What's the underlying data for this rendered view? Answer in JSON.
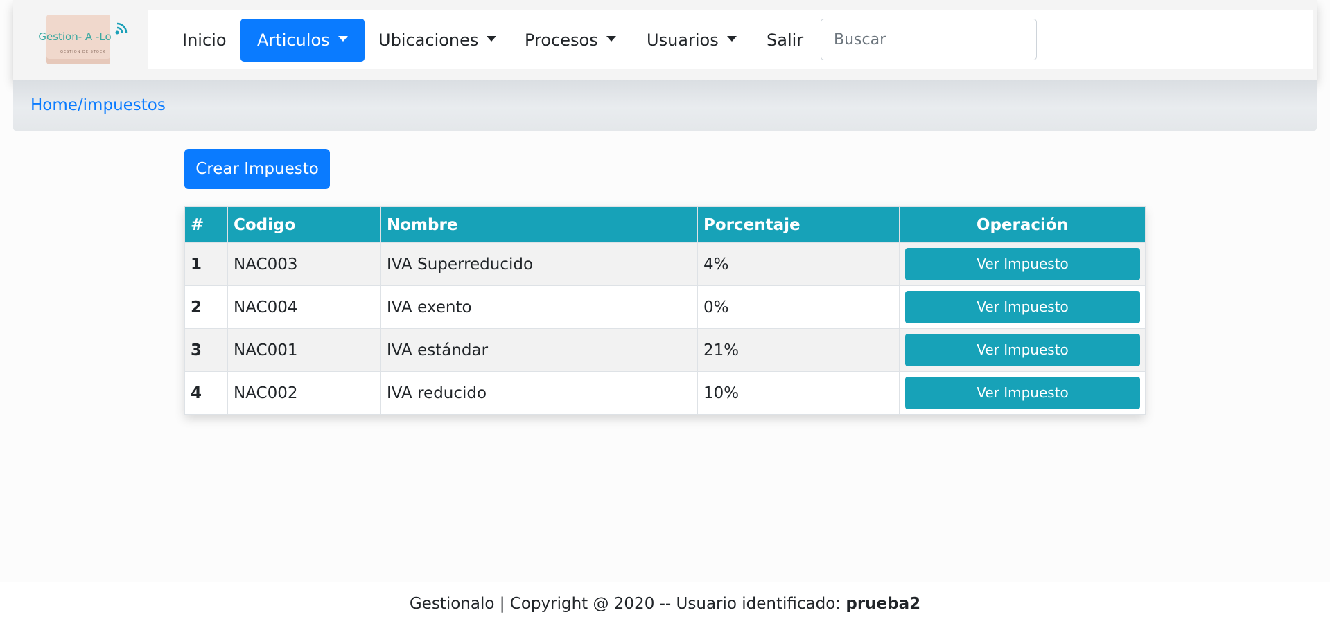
{
  "brand": {
    "logo_text": "Gestion- A -Lo",
    "logo_subtext": "GESTION DE STOCK"
  },
  "nav": {
    "inicio": "Inicio",
    "articulos": "Articulos",
    "ubicaciones": "Ubicaciones",
    "procesos": "Procesos",
    "usuarios": "Usuarios",
    "salir": "Salir",
    "active_item": "Articulos",
    "search_placeholder": "Buscar"
  },
  "breadcrumb": "Home/impuestos",
  "create_button": "Crear Impuesto",
  "table": {
    "headers": [
      "#",
      "Codigo",
      "Nombre",
      "Porcentaje",
      "Operación"
    ],
    "rows": [
      {
        "num": "1",
        "codigo": "NAC003",
        "nombre": "IVA Superreducido",
        "porcentaje": "4%",
        "action": "Ver Impuesto"
      },
      {
        "num": "2",
        "codigo": "NAC004",
        "nombre": "IVA exento",
        "porcentaje": "0%",
        "action": "Ver Impuesto"
      },
      {
        "num": "3",
        "codigo": "NAC001",
        "nombre": "IVA estándar",
        "porcentaje": "21%",
        "action": "Ver Impuesto"
      },
      {
        "num": "4",
        "codigo": "NAC002",
        "nombre": "IVA reducido",
        "porcentaje": "10%",
        "action": "Ver Impuesto"
      }
    ]
  },
  "footer": {
    "text": "Gestionalo | Copyright @ 2020 -- Usuario identificado: ",
    "user": "prueba2"
  },
  "colors": {
    "primary": "#0a7bff",
    "info": "#17a2b8",
    "breadcrumb_bg": "#e9ecef"
  },
  "icons": {
    "logo": "box-logo-with-wifi-icon",
    "dropdown": "caret-down-icon"
  }
}
